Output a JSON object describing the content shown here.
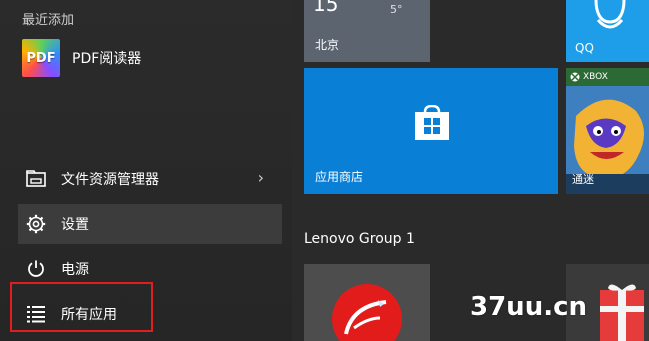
{
  "start_menu": {
    "recently_added_title": "最近添加",
    "recent_apps": [
      {
        "label": "PDF阅读器",
        "icon_text": "PDF",
        "icon": "pdf-reader-icon"
      }
    ],
    "items": [
      {
        "label": "文件资源管理器",
        "icon": "file-explorer-icon",
        "chevron": "›"
      },
      {
        "label": "设置",
        "icon": "gear-icon"
      },
      {
        "label": "电源",
        "icon": "power-icon"
      },
      {
        "label": "所有应用",
        "icon": "list-icon"
      }
    ]
  },
  "tiles": {
    "weather": {
      "temp": "15",
      "degree": "5°",
      "city": "北京"
    },
    "qq": {
      "label": "QQ"
    },
    "store": {
      "label": "应用商店"
    },
    "xbox": {
      "brand": "XBOX",
      "label": "通迷"
    },
    "group_title": "Lenovo Group 1"
  },
  "watermark": "37uu.cn",
  "colors": {
    "background": "#242424",
    "store_blue": "#0a7fd6",
    "qq_blue": "#1e9ee8",
    "xbox_green": "#2b6a34",
    "highlight_red": "#e11d1d",
    "lenovo_red": "#e21b1b"
  }
}
